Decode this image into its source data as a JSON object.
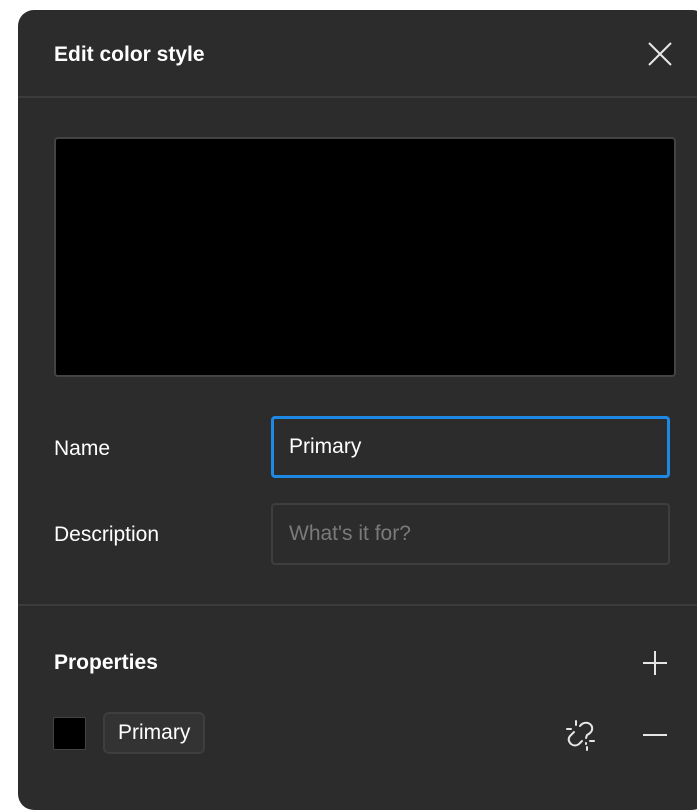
{
  "dialog": {
    "title": "Edit color style",
    "preview_color": "#000000"
  },
  "form": {
    "name_label": "Name",
    "name_value": "Primary",
    "description_label": "Description",
    "description_value": "",
    "description_placeholder": "What's it for?"
  },
  "properties": {
    "title": "Properties",
    "items": [
      {
        "swatch_color": "#000000",
        "style_name": "Primary",
        "detach_icon": "unlink-icon",
        "remove_icon": "minus-icon"
      }
    ],
    "add_icon": "plus-icon"
  },
  "icons": {
    "close": "close-icon"
  },
  "colors": {
    "panel_background": "#2c2c2c",
    "focus_accent": "#1e88e5",
    "text": "#ffffff",
    "placeholder": "#7a7a7a"
  }
}
